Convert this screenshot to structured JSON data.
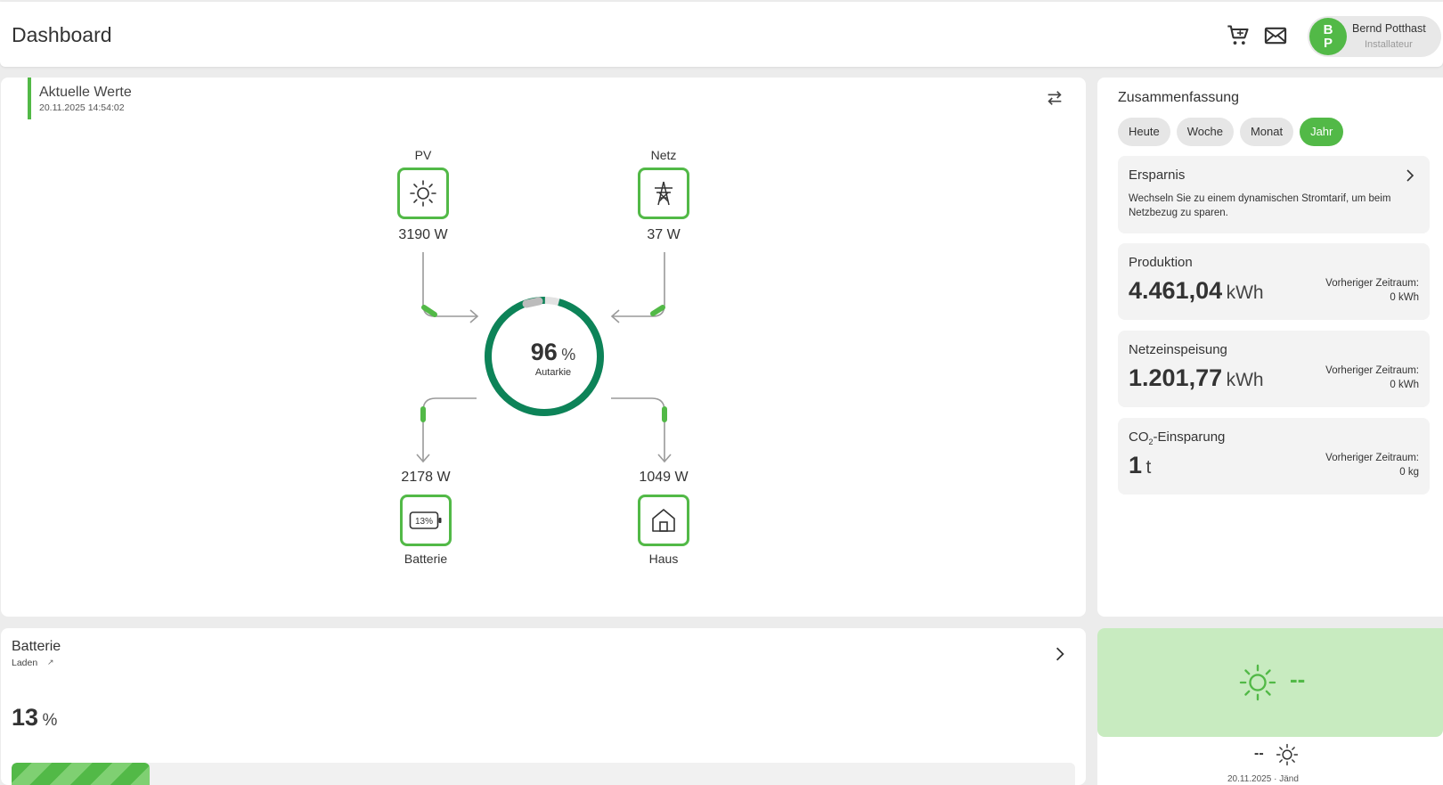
{
  "header": {
    "title": "Dashboard",
    "cart_icon": "cart-icon",
    "mail_icon": "mail-icon",
    "user": {
      "initials_1": "B",
      "initials_2": "P",
      "name": "Bernd Potthast",
      "role": "Installateur"
    }
  },
  "current_values": {
    "title": "Aktuelle Werte",
    "timestamp": "20.11.2025 14:54:02",
    "pv": {
      "label": "PV",
      "value": "3190 W",
      "icon": "sun-icon"
    },
    "grid": {
      "label": "Netz",
      "value": "37 W",
      "icon": "power-tower-icon"
    },
    "battery": {
      "label": "Batterie",
      "value": "2178 W",
      "icon_text": "13%",
      "icon": "battery-icon"
    },
    "house": {
      "label": "Haus",
      "value": "1049 W",
      "icon": "house-icon"
    },
    "autarky": {
      "value": "96",
      "unit": "%",
      "label": "Autarkie",
      "fraction": 0.96
    },
    "colors": {
      "accent": "#52b947",
      "gauge": "#0d8358"
    }
  },
  "summary": {
    "title": "Zusammenfassung",
    "periods": [
      "Heute",
      "Woche",
      "Monat",
      "Jahr"
    ],
    "active_period": "Jahr",
    "savings": {
      "title": "Ersparnis",
      "text": "Wechseln Sie zu einem dynamischen Stromtarif, um beim Netzbezug zu sparen."
    },
    "production": {
      "title": "Produktion",
      "value": "4.461,04",
      "unit": "kWh",
      "prev_label": "Vorheriger Zeitraum:",
      "prev_value": "0 kWh"
    },
    "feed_in": {
      "title": "Netzeinspeisung",
      "value": "1.201,77",
      "unit": "kWh",
      "prev_label": "Vorheriger Zeitraum:",
      "prev_value": "0 kWh"
    },
    "co2": {
      "title_prefix": "CO",
      "title_sub": "2",
      "title_suffix": "-Einsparung",
      "value": "1",
      "unit": "t",
      "prev_label": "Vorheriger Zeitraum:",
      "prev_value": "0 kg"
    }
  },
  "battery_card": {
    "title": "Batterie",
    "status": "Laden",
    "status_arrow": "↗",
    "value": "13",
    "unit": "%",
    "fill_fraction": 0.13
  },
  "weather": {
    "big_value": "--",
    "small_value": "--",
    "date_partial": "20.11.2025 · Jänd"
  }
}
